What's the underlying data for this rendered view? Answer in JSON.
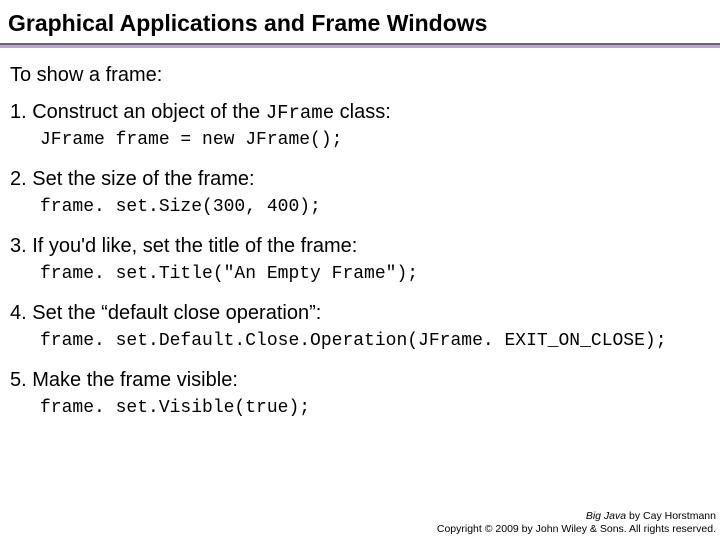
{
  "title": "Graphical Applications and Frame Windows",
  "lead": "To show a frame:",
  "steps": {
    "s1_pre": "1. Construct an object of the ",
    "s1_mono": "JFrame",
    "s1_post": " class:",
    "c1": "JFrame frame = new JFrame();",
    "s2": "2. Set the size of the frame:",
    "c2": "frame. set.Size(300, 400);",
    "s3": "3. If you'd like, set the title of the frame:",
    "c3": "frame. set.Title(\"An Empty Frame\");",
    "s4": "4. Set the “default close operation”:",
    "c4": "frame. set.Default.Close.Operation(JFrame. EXIT_ON_CLOSE);",
    "s5": "5. Make the frame visible:",
    "c5": "frame. set.Visible(true);"
  },
  "footer": {
    "line1_book": "Big Java",
    "line1_rest": " by Cay Horstmann",
    "line2": "Copyright © 2009 by John Wiley & Sons. All rights reserved."
  }
}
